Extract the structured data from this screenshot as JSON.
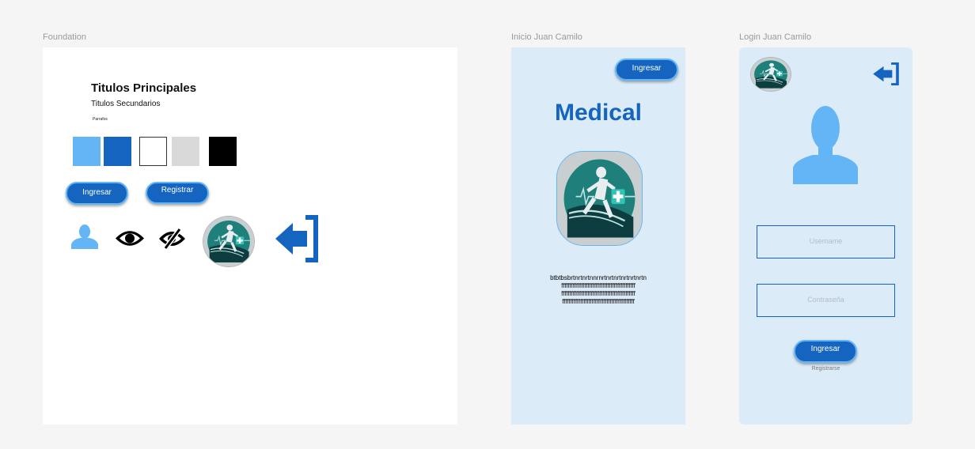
{
  "frames": {
    "foundation": {
      "label": "Foundation"
    },
    "inicio": {
      "label": "Inicio Juan Camilo"
    },
    "login": {
      "label": "Login Juan Camilo"
    }
  },
  "foundation": {
    "heading_primary": "Titulos Principales",
    "heading_secondary": "Titulos Secundarios",
    "paragraph_sample": "Parrafos",
    "palette": [
      "#64b5f6",
      "#1565c0",
      "#ffffff",
      "#d9d9d9",
      "#000000"
    ],
    "buttons": {
      "ingresar": "Ingresar",
      "registrar": "Registrar"
    },
    "icons": [
      "user-icon",
      "eye-icon",
      "eye-off-icon",
      "logo-icon",
      "login-arrow-icon"
    ]
  },
  "inicio": {
    "ingresar_button": "Ingresar",
    "title": "Medical",
    "body_lines": [
      "btbtbsbrtnrtnrtnnrnrtnrtnrtnrtnrtnrtn",
      "fffffffffffffffffffffffffffffffffffffffffffff",
      "fffffffffffffffffffffffffffffffffffffffffffff",
      "ffffffffffffffffffffffffffffffffffffffffffff"
    ]
  },
  "login": {
    "username_placeholder": "Username",
    "password_placeholder": "Contraseña",
    "ingresar_button": "Ingresar",
    "register_link": "Registrarse"
  },
  "colors": {
    "primary": "#1565c0",
    "light_blue": "#64b5f6",
    "frame_bg": "#dcebf8",
    "teal": "#2a8c86"
  }
}
